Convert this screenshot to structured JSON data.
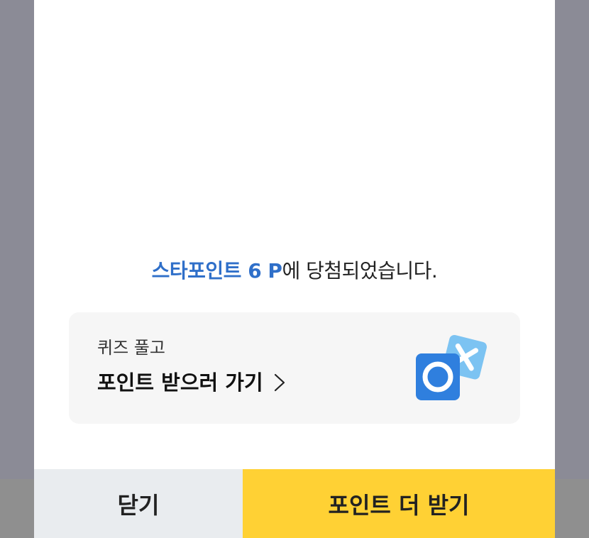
{
  "dialog": {
    "message": {
      "highlight": "스타포인트 6 P",
      "rest": "에 당첨되었습니다."
    },
    "quiz_card": {
      "subtitle": "퀴즈 풀고",
      "title": "포인트 받으러 가기",
      "icon": "ox-quiz-icon"
    },
    "buttons": {
      "close_label": "닫기",
      "more_label": "포인트 더 받기"
    }
  },
  "colors": {
    "overlay": "#8b8b96",
    "highlight": "#2f6fc9",
    "close_button_bg": "#e9ecef",
    "more_button_bg": "#ffd134",
    "card_bg": "#f6f6f6"
  }
}
